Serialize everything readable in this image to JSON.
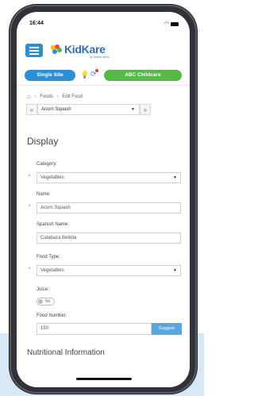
{
  "status_bar": {
    "time": "16:44"
  },
  "app": {
    "logo_text": "KidKare",
    "logo_sub": "by Minute Menu"
  },
  "site_bar": {
    "single_site": "Single Site",
    "center_name": "ABC Childcare"
  },
  "breadcrumb": {
    "items": [
      "Foods",
      "Edit Food"
    ]
  },
  "food_nav": {
    "selected": "Acorn Squash",
    "prev": "«",
    "next": "»"
  },
  "display": {
    "title": "Display",
    "category_label": "Category:",
    "category_value": "Vegetables",
    "name_label": "Name:",
    "name_value": "Acorn Squash",
    "spanish_label": "Spanish Name:",
    "spanish_value": "Calabaza Bellota",
    "food_type_label": "Food Type:",
    "food_type_value": "Vegetables",
    "juice_label": "Juice:",
    "juice_value": "No",
    "food_number_label": "Food Number:",
    "food_number_value": "150",
    "suggest_label": "Suggest",
    "required_mark": "*"
  },
  "nutritional": {
    "title": "Nutritional Information"
  },
  "colors": {
    "primary": "#2f8fd4",
    "green": "#5ab54b",
    "suggest": "#5da5da"
  }
}
